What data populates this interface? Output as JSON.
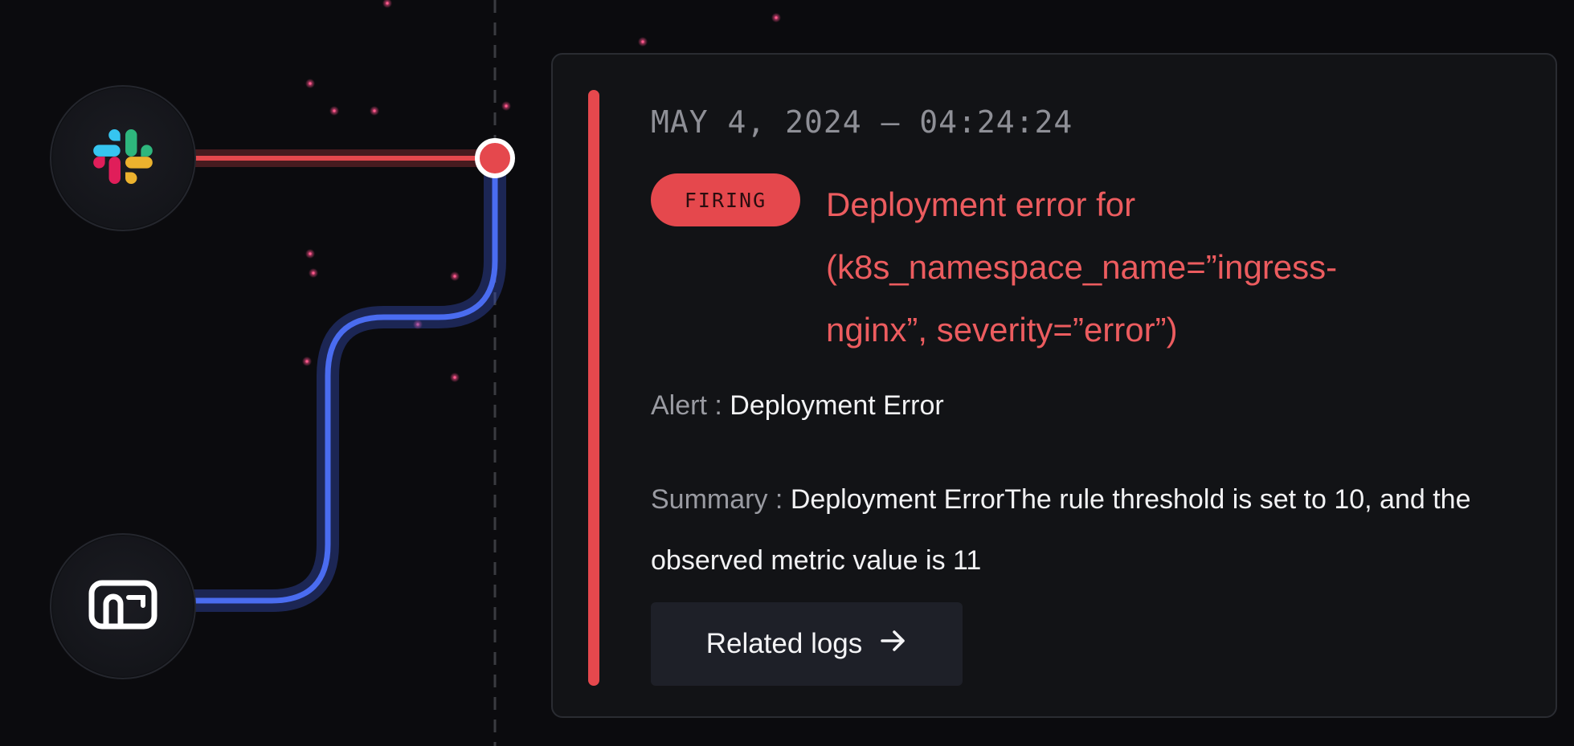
{
  "colors": {
    "background": "#0b0b0e",
    "card_background": "#121316",
    "accent_red": "#e5484d",
    "connector_blue": "#4a6cf0",
    "title_red": "#ec5c5f",
    "button_background": "#1e2028"
  },
  "flow": {
    "nodes": [
      {
        "name": "slack",
        "icon": "slack-logo-icon"
      },
      {
        "name": "inbox",
        "icon": "inbox-icon"
      }
    ]
  },
  "alert_card": {
    "timestamp": "MAY 4, 2024 — 04:24:24",
    "status_badge": "FIRING",
    "title": "Deployment error for (k8s_namespace_name=”ingress-nginx”, severity=”error”)",
    "alert_label": "Alert :",
    "alert_value": "Deployment Error",
    "summary_label": "Summary :",
    "summary_value": "Deployment ErrorThe rule threshold is set to 10, and the observed metric value is 11",
    "related_logs_label": "Related logs",
    "related_logs_icon": "arrow-right-icon"
  }
}
